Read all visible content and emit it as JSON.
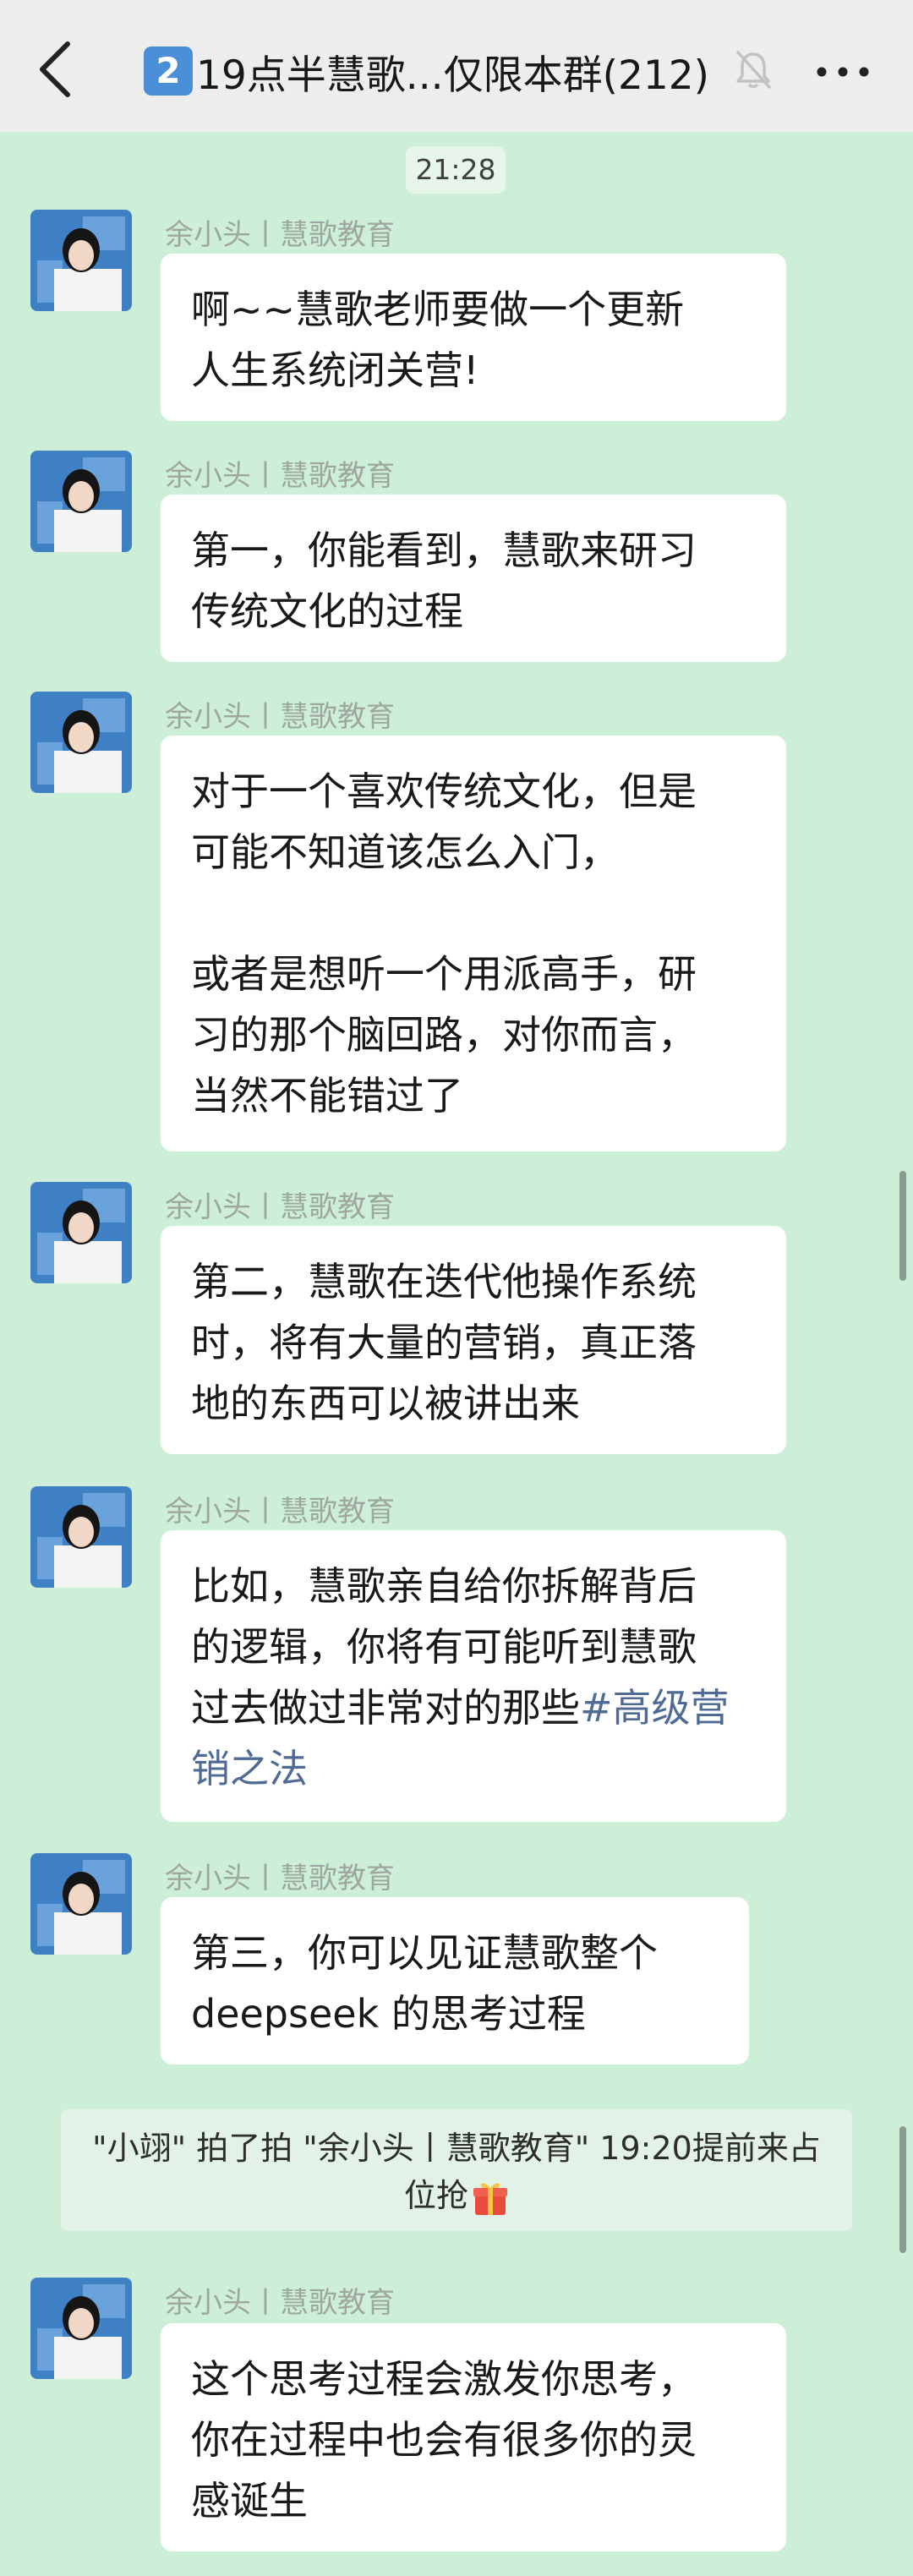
{
  "header": {
    "badge": "2",
    "title": "19点半慧歌...仅限本群(212)",
    "icons": [
      "back-arrow-icon",
      "mute-bell-icon",
      "more-icon"
    ]
  },
  "time": "21:28",
  "sender_name": "余小头丨慧歌教育",
  "messages": [
    {
      "lines": [
        "啊~~慧歌老师要做一个更新",
        "人生系统闭关营!"
      ]
    },
    {
      "lines": [
        "第一，你能看到，慧歌来研习",
        "传统文化的过程"
      ]
    },
    {
      "lines": [
        "对于一个喜欢传统文化，但是",
        "可能不知道该怎么入门，",
        "",
        "或者是想听一个用派高手，研",
        "习的那个脑回路，对你而言，",
        "当然不能错过了"
      ]
    },
    {
      "lines": [
        "第二，慧歌在迭代他操作系统",
        "时，将有大量的营销，真正落",
        "地的东西可以被讲出来"
      ]
    },
    {
      "lines": [
        "比如，慧歌亲自给你拆解背后",
        "的逻辑，你将有可能听到慧歌",
        "过去做过非常对的那些"
      ],
      "link": [
        "#高级营",
        "销之法"
      ]
    },
    {
      "lines": [
        "第三，你可以见证慧歌整个",
        "deepseek 的思考过程"
      ]
    },
    {
      "lines": [
        "这个思考过程会激发你思考，",
        "你在过程中也会有很多你的灵",
        "感诞生"
      ]
    }
  ],
  "system_notice": {
    "line1": "\"小翊\" 拍了拍 \"余小头丨慧歌教育\" 19:20提前来占",
    "line2": "位抢"
  },
  "colors": {
    "background": "#cdeed7",
    "bubble": "#ffffff",
    "link": "#4f6b95",
    "badge": "#4b8fd6"
  }
}
